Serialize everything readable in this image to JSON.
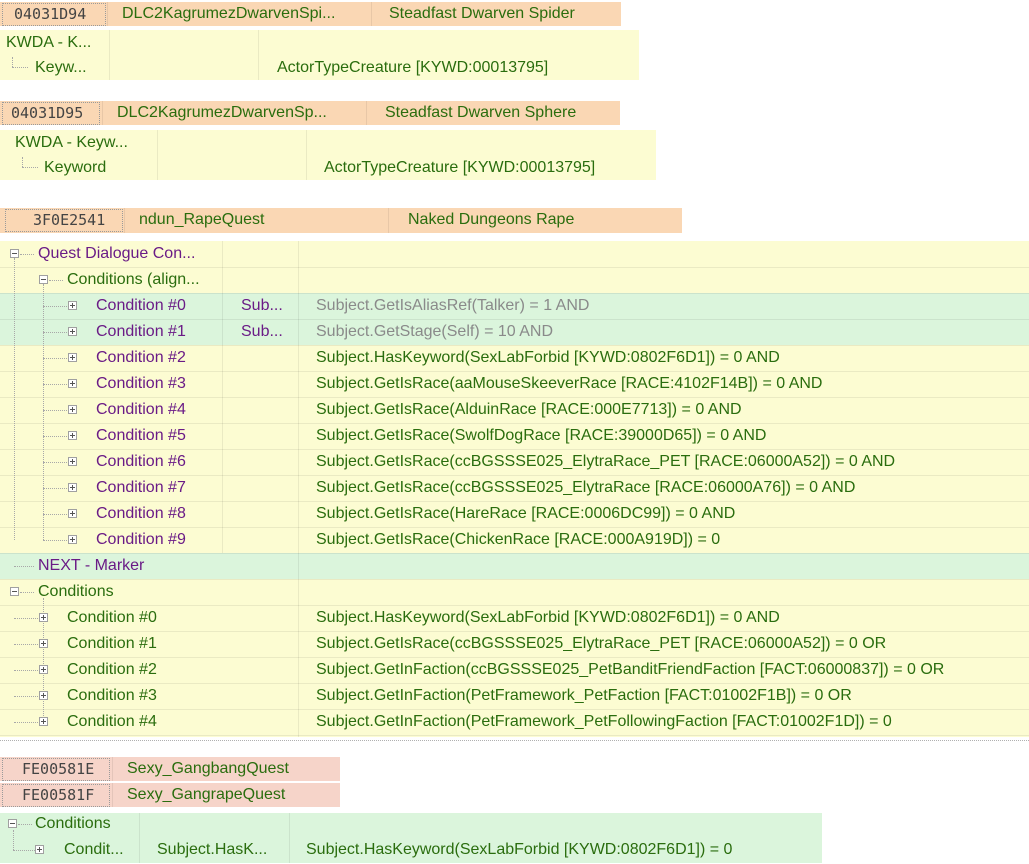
{
  "record1": {
    "formid": "04031D94",
    "edid": "DLC2KagrumezDwarvenSpi...",
    "name": "Steadfast Dwarven Spider",
    "kwda": "KWDA - K...",
    "keyword_label": "Keyw...",
    "keyword_value": "ActorTypeCreature [KYWD:00013795]"
  },
  "record2": {
    "formid": "04031D95",
    "edid": "DLC2KagrumezDwarvenSp...",
    "name": "Steadfast Dwarven Sphere",
    "kwda": "KWDA - Keyw...",
    "keyword_label": "Keyword",
    "keyword_value": "ActorTypeCreature [KYWD:00013795]"
  },
  "record3": {
    "formid": "3F0E2541",
    "edid": "ndun_RapeQuest",
    "name": "Naked Dungeons Rape",
    "qdc": "Quest Dialogue Con...",
    "cond_group": "Conditions (align...",
    "dialogue_conditions": [
      {
        "label": "Condition #0",
        "sub": "Sub...",
        "value": "Subject.GetIsAliasRef(Talker) = 1 AND"
      },
      {
        "label": "Condition #1",
        "sub": "Sub...",
        "value": "Subject.GetStage(Self) = 10 AND"
      },
      {
        "label": "Condition #2",
        "sub": "",
        "value": "Subject.HasKeyword(SexLabForbid [KYWD:0802F6D1]) = 0 AND"
      },
      {
        "label": "Condition #3",
        "sub": "",
        "value": "Subject.GetIsRace(aaMouseSkeeverRace [RACE:4102F14B]) = 0 AND"
      },
      {
        "label": "Condition #4",
        "sub": "",
        "value": "Subject.GetIsRace(AlduinRace [RACE:000E7713]) = 0 AND"
      },
      {
        "label": "Condition #5",
        "sub": "",
        "value": "Subject.GetIsRace(SwolfDogRace [RACE:39000D65]) = 0 AND"
      },
      {
        "label": "Condition #6",
        "sub": "",
        "value": "Subject.GetIsRace(ccBGSSSE025_ElytraRace_PET [RACE:06000A52]) = 0 AND"
      },
      {
        "label": "Condition #7",
        "sub": "",
        "value": "Subject.GetIsRace(ccBGSSSE025_ElytraRace [RACE:06000A76]) = 0 AND"
      },
      {
        "label": "Condition #8",
        "sub": "",
        "value": "Subject.GetIsRace(HareRace [RACE:0006DC99]) = 0 AND"
      },
      {
        "label": "Condition #9",
        "sub": "",
        "value": "Subject.GetIsRace(ChickenRace [RACE:000A919D]) = 0"
      }
    ],
    "next_marker": "NEXT - Marker",
    "conditions_label": "Conditions",
    "conditions": [
      {
        "label": "Condition #0",
        "value": "Subject.HasKeyword(SexLabForbid [KYWD:0802F6D1]) = 0 AND"
      },
      {
        "label": "Condition #1",
        "value": "Subject.GetIsRace(ccBGSSSE025_ElytraRace_PET [RACE:06000A52]) = 0 OR"
      },
      {
        "label": "Condition #2",
        "value": "Subject.GetInFaction(ccBGSSSE025_PetBanditFriendFaction [FACT:06000837]) = 0 OR"
      },
      {
        "label": "Condition #3",
        "value": "Subject.GetInFaction(PetFramework_PetFaction [FACT:01002F1B]) = 0 OR"
      },
      {
        "label": "Condition #4",
        "value": "Subject.GetInFaction(PetFramework_PetFollowingFaction [FACT:01002F1D]) = 0"
      }
    ]
  },
  "record4": {
    "formid": "FE00581E",
    "edid": "Sexy_GangbangQuest"
  },
  "record5": {
    "formid": "FE00581F",
    "edid": "Sexy_GangrapeQuest",
    "conditions_label": "Conditions",
    "cond_label": "Condit...",
    "cond_sub": "Subject.HasK...",
    "cond_value": "Subject.HasKeyword(SexLabForbid [KYWD:0802F6D1]) = 0"
  },
  "colors": {
    "orange": "#fad7b4",
    "yellow": "#fcfcd2",
    "green": "#dbf5dc",
    "pink": "#f6d4c9",
    "text_green": "#2a6d0e",
    "text_purple": "#6a1b86"
  }
}
